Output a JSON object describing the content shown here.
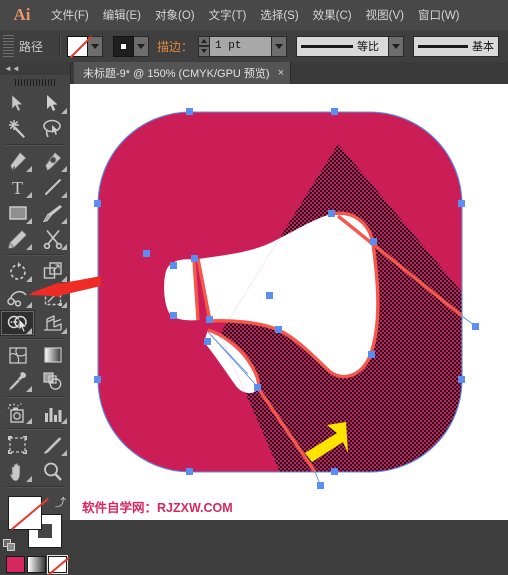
{
  "app": {
    "name": "Adobe Illustrator",
    "logo_text": "Ai"
  },
  "menubar": {
    "items": [
      {
        "label": "文件(F)",
        "name": "menu-file"
      },
      {
        "label": "编辑(E)",
        "name": "menu-edit"
      },
      {
        "label": "对象(O)",
        "name": "menu-object"
      },
      {
        "label": "文字(T)",
        "name": "menu-type"
      },
      {
        "label": "选择(S)",
        "name": "menu-select"
      },
      {
        "label": "效果(C)",
        "name": "menu-effect"
      },
      {
        "label": "视图(V)",
        "name": "menu-view"
      },
      {
        "label": "窗口(W)",
        "name": "menu-window"
      }
    ]
  },
  "controlbar": {
    "selection_label": "路径",
    "fill_swatch": "none",
    "stroke_swatch": "square",
    "stroke_label": "描边：",
    "stroke_weight": "1 pt",
    "profile_uniform": "等比",
    "profile_basic": "基本"
  },
  "tabs": {
    "documents": [
      {
        "title": "未标题-9* @ 150% (CMYK/GPU 预览)",
        "close": "×",
        "active": true
      }
    ]
  },
  "toolbar": {
    "collapse_glyph": "◄◄",
    "tools": [
      {
        "name": "selection-tool",
        "icon": "arrow-solid",
        "corner": false,
        "selected": false
      },
      {
        "name": "direct-selection-tool",
        "icon": "arrow-hollow",
        "corner": true,
        "selected": false
      },
      {
        "name": "magic-wand-tool",
        "icon": "magic-wand",
        "corner": false,
        "selected": false
      },
      {
        "name": "lasso-tool",
        "icon": "lasso",
        "corner": false,
        "selected": false
      },
      {
        "name": "pen-tool",
        "icon": "pen",
        "corner": true,
        "selected": false
      },
      {
        "name": "curvature-tool",
        "icon": "curvature-pen",
        "corner": true,
        "selected": false
      },
      {
        "name": "type-tool",
        "icon": "type-T",
        "corner": true,
        "selected": false
      },
      {
        "name": "line-segment-tool",
        "icon": "line-segment",
        "corner": true,
        "selected": false
      },
      {
        "name": "rectangle-tool",
        "icon": "rectangle",
        "corner": true,
        "selected": false
      },
      {
        "name": "paintbrush-tool",
        "icon": "paintbrush",
        "corner": true,
        "selected": false
      },
      {
        "name": "pencil-tool",
        "icon": "pencil",
        "corner": true,
        "selected": false
      },
      {
        "name": "scissors-tool",
        "icon": "scissors",
        "corner": true,
        "selected": false
      },
      {
        "name": "rotate-tool",
        "icon": "rotate",
        "corner": true,
        "selected": false
      },
      {
        "name": "scale-tool",
        "icon": "scale",
        "corner": true,
        "selected": false
      },
      {
        "name": "width-tool",
        "icon": "width-warp",
        "corner": true,
        "selected": false
      },
      {
        "name": "free-transform-tool",
        "icon": "free-transform",
        "corner": true,
        "selected": false
      },
      {
        "name": "shape-builder-tool",
        "icon": "shape-builder",
        "corner": true,
        "selected": true
      },
      {
        "name": "perspective-grid-tool",
        "icon": "perspective-grid",
        "corner": true,
        "selected": false
      },
      {
        "name": "mesh-tool",
        "icon": "mesh",
        "corner": false,
        "selected": false
      },
      {
        "name": "gradient-tool",
        "icon": "gradient",
        "corner": false,
        "selected": false
      },
      {
        "name": "eyedropper-tool",
        "icon": "eyedropper",
        "corner": true,
        "selected": false
      },
      {
        "name": "blend-tool",
        "icon": "blend",
        "corner": false,
        "selected": false
      },
      {
        "name": "symbol-sprayer-tool",
        "icon": "symbol-sprayer",
        "corner": true,
        "selected": false
      },
      {
        "name": "column-graph-tool",
        "icon": "column-graph",
        "corner": true,
        "selected": false
      },
      {
        "name": "artboard-tool",
        "icon": "artboard",
        "corner": false,
        "selected": false
      },
      {
        "name": "slice-tool",
        "icon": "slice-knife",
        "corner": true,
        "selected": false
      },
      {
        "name": "hand-tool",
        "icon": "hand",
        "corner": true,
        "selected": false
      },
      {
        "name": "zoom-tool",
        "icon": "magnifier",
        "corner": false,
        "selected": false
      }
    ],
    "fill_value": "none",
    "stroke_value": "white",
    "swap_glyph": "⤴",
    "bottom_swatches": [
      {
        "name": "color-swatch",
        "kind": "color",
        "color": "#d6285e",
        "selected": false
      },
      {
        "name": "gradient-swatch",
        "kind": "gradient",
        "selected": false
      },
      {
        "name": "none-swatch",
        "kind": "none",
        "selected": true
      }
    ]
  },
  "canvas": {
    "watermark": "软件自学网：RJZXW.COM",
    "artwork": {
      "name": "megaphone-icon-artwork",
      "background_color": "#cc1e56",
      "shape_color": "#ffffff",
      "selection_path_color": "#5a8ef0",
      "highlight_stroke_color": "#f4574b",
      "hatch_overlay": true
    },
    "annotations": [
      {
        "name": "red-arrow-annotation",
        "color": "#ee2b24",
        "points_to": "shape-builder-tool"
      },
      {
        "name": "yellow-arrow-annotation",
        "color": "#ffe400",
        "points_to": "shape-builder-highlight-region"
      }
    ]
  }
}
